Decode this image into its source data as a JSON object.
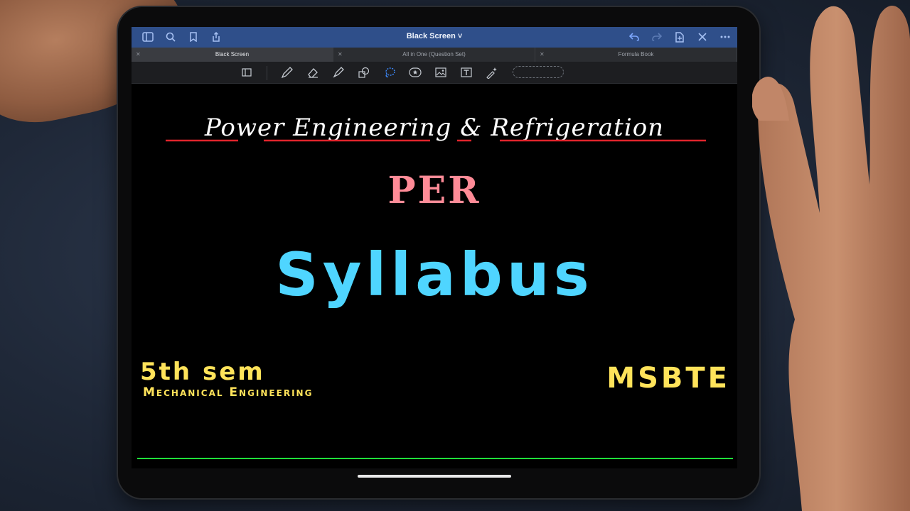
{
  "navbar": {
    "title": "Black Screen ˅",
    "left_icons": [
      "sidebar-icon",
      "search-icon",
      "bookmark-icon",
      "share-icon"
    ],
    "right_icons": [
      "undo-icon",
      "redo-icon",
      "add-page-icon",
      "close-icon",
      "more-icon"
    ]
  },
  "tabs": [
    {
      "label": "Black Screen",
      "active": true
    },
    {
      "label": "All in One (Question Set)",
      "active": false
    },
    {
      "label": "Formula Book",
      "active": false
    }
  ],
  "toolbar": {
    "tools": [
      "reading-mode-icon",
      "pen-icon",
      "eraser-icon",
      "highlighter-icon",
      "shapes-icon",
      "lasso-icon",
      "sticker-icon",
      "image-icon",
      "text-icon",
      "laser-pointer-icon"
    ],
    "selected_tool": "lasso-icon"
  },
  "canvas": {
    "title": "Power Engineering & Refrigeration",
    "abbr": "PER",
    "heading": "Syllabus",
    "semester": "5th sem",
    "branch": "Mechanical Engineering",
    "board": "MSBTE"
  },
  "colors": {
    "navbar": "#2f4f8a",
    "title": "#ffffff",
    "underline": "#e0242c",
    "abbr": "#ff8b97",
    "heading": "#4fd5ff",
    "yellow_text": "#ffe35a",
    "bottom_line": "#1fe03a"
  }
}
